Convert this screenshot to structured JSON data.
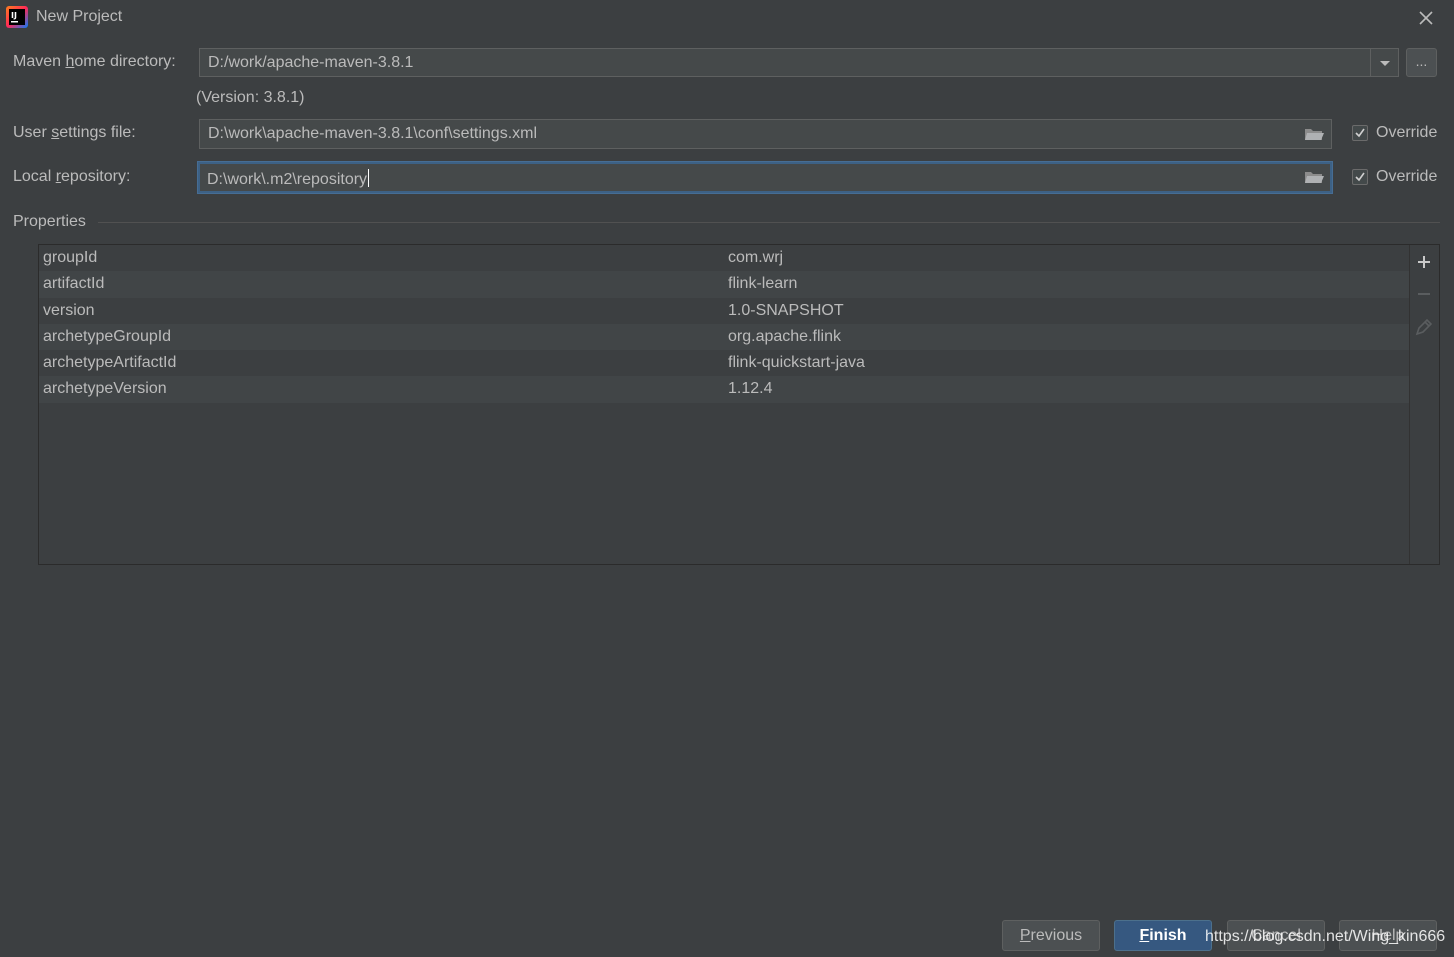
{
  "window": {
    "title": "New Project",
    "close_icon": "close-icon",
    "app_icon": "intellij-icon"
  },
  "maven_home": {
    "label_pre": "Maven ",
    "label_mnemonic": "h",
    "label_post": "ome directory:",
    "value": "D:/work/apache-maven-3.8.1",
    "browse_label": "...",
    "version_text": "(Version: 3.8.1)"
  },
  "user_settings": {
    "label_pre": "User ",
    "label_mnemonic": "s",
    "label_post": "ettings file:",
    "value": "D:\\work\\apache-maven-3.8.1\\conf\\settings.xml",
    "override_label": "Override",
    "override_checked": true
  },
  "local_repo": {
    "label_pre": "Local ",
    "label_mnemonic": "r",
    "label_post": "epository:",
    "value": "D:\\work\\.m2\\repository",
    "override_label": "Override",
    "override_checked": true
  },
  "properties": {
    "title": "Properties",
    "rows": [
      {
        "key": "groupId",
        "value": "com.wrj"
      },
      {
        "key": "artifactId",
        "value": "flink-learn"
      },
      {
        "key": "version",
        "value": "1.0-SNAPSHOT"
      },
      {
        "key": "archetypeGroupId",
        "value": "org.apache.flink"
      },
      {
        "key": "archetypeArtifactId",
        "value": "flink-quickstart-java"
      },
      {
        "key": "archetypeVersion",
        "value": "1.12.4"
      }
    ],
    "toolbar": [
      "add-icon",
      "remove-icon",
      "edit-icon"
    ]
  },
  "buttons": {
    "previous_mnemonic": "P",
    "previous_rest": "revious",
    "finish_mnemonic": "F",
    "finish_rest": "inish",
    "cancel": "Cancel",
    "help": "Help"
  },
  "watermark": "https://blog.csdn.net/Wing_kin666",
  "colors": {
    "background": "#3c3f41",
    "field": "#45494a",
    "primary_button": "#365880",
    "focus_border": "#3d6185"
  }
}
